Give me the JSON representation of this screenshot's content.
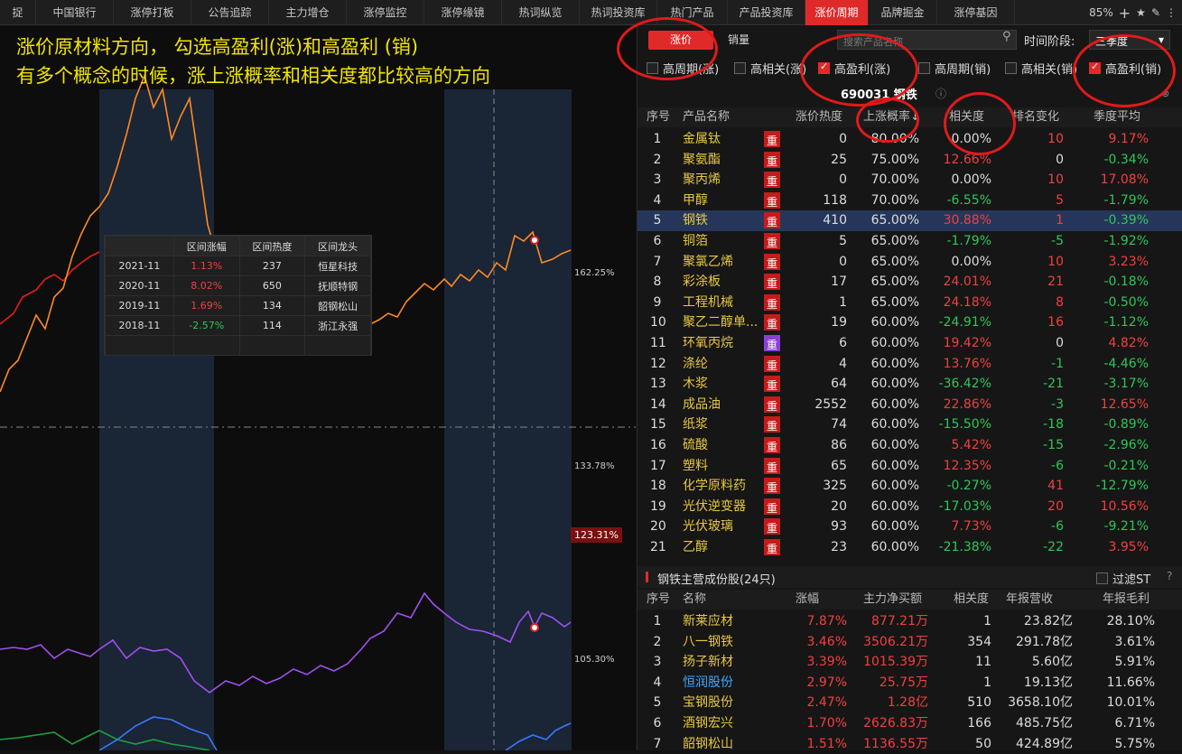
{
  "tabs": [
    "捉",
    "中国银行",
    "涨停打板",
    "公告追踪",
    "主力增仓",
    "涨停监控",
    "涨停缘镜",
    "热词纵览",
    "热词投资库",
    "热门产品",
    "产品投资库",
    "涨价周期",
    "品牌掘金",
    "涨停基因"
  ],
  "active_tab": 11,
  "topright": {
    "zoom": "85%",
    "plus": "+",
    "star": "★",
    "pen": "✎",
    "menu": "⋮"
  },
  "annotation": {
    "line1": "涨价原材料方向， 勾选高盈利(涨)和高盈利 (销)",
    "line2": "有多个概念的时候，涨上涨概率和相关度都比较高的方向"
  },
  "chart": {
    "labels": [
      "162.25%",
      "133.78%",
      "105.30%"
    ],
    "highlight": "123.31%",
    "colors": {
      "orange": "#ff8a1e",
      "red": "#e81c1c",
      "purple": "#a050f0",
      "blue": "#3a78ff",
      "green": "#1ea040"
    }
  },
  "interval_table": {
    "headers": [
      "",
      "区间涨幅",
      "区间热度",
      "区间龙头"
    ],
    "rows": [
      [
        "2021-11",
        "1.13%",
        "237",
        "恒星科技"
      ],
      [
        "2020-11",
        "8.02%",
        "650",
        "抚顺特钢"
      ],
      [
        "2019-11",
        "1.69%",
        "134",
        "韶钢松山"
      ],
      [
        "2018-11",
        "-2.57%",
        "114",
        "浙江永强"
      ]
    ]
  },
  "controls": {
    "price_btn": "涨价",
    "sales_btn": "销量",
    "search_placeholder": "搜索产品名称",
    "period_label": "时间阶段:",
    "period_value": "三季度",
    "period_arrow": "▾",
    "search_icon": "⚲"
  },
  "checkboxes": [
    {
      "label": "高周期(涨)",
      "on": false
    },
    {
      "label": "高相关(涨)",
      "on": false
    },
    {
      "label": "高盈利(涨)",
      "on": true
    },
    {
      "label": "高周期(销)",
      "on": false
    },
    {
      "label": "高相关(销)",
      "on": false
    },
    {
      "label": "高盈利(销)",
      "on": true
    }
  ],
  "product_title": "690031 钢铁",
  "info_icon": "ⓘ",
  "close_icon": "⊗",
  "table1": {
    "headers": [
      "序号",
      "产品名称",
      "涨价热度",
      "上涨概率↓",
      "相关度",
      "排名变化",
      "季度平均"
    ],
    "rows": [
      [
        "1",
        "金属钛",
        "重",
        "0",
        "80.00%",
        "0.00%",
        "10",
        "9.17%"
      ],
      [
        "2",
        "聚氨酯",
        "重",
        "25",
        "75.00%",
        "12.66%",
        "0",
        "-0.34%"
      ],
      [
        "3",
        "聚丙烯",
        "重",
        "0",
        "70.00%",
        "0.00%",
        "10",
        "17.08%"
      ],
      [
        "4",
        "甲醇",
        "重",
        "118",
        "70.00%",
        "-6.55%",
        "5",
        "-1.79%"
      ],
      [
        "5",
        "钢铁",
        "重",
        "410",
        "65.00%",
        "30.88%",
        "1",
        "-0.39%"
      ],
      [
        "6",
        "铜箔",
        "重",
        "5",
        "65.00%",
        "-1.79%",
        "-5",
        "-1.92%"
      ],
      [
        "7",
        "聚氯乙烯",
        "重",
        "0",
        "65.00%",
        "0.00%",
        "10",
        "3.23%"
      ],
      [
        "8",
        "彩涂板",
        "重",
        "17",
        "65.00%",
        "24.01%",
        "21",
        "-0.18%"
      ],
      [
        "9",
        "工程机械",
        "重",
        "1",
        "65.00%",
        "24.18%",
        "8",
        "-0.50%"
      ],
      [
        "10",
        "聚乙二醇单...",
        "重",
        "19",
        "60.00%",
        "-24.91%",
        "16",
        "-1.12%"
      ],
      [
        "11",
        "环氧丙烷",
        "重",
        "6",
        "60.00%",
        "19.42%",
        "0",
        "4.82%"
      ],
      [
        "12",
        "涤纶",
        "重",
        "4",
        "60.00%",
        "13.76%",
        "-1",
        "-4.46%"
      ],
      [
        "13",
        "木浆",
        "重",
        "64",
        "60.00%",
        "-36.42%",
        "-21",
        "-3.17%"
      ],
      [
        "14",
        "成品油",
        "重",
        "2552",
        "60.00%",
        "22.86%",
        "-3",
        "12.65%"
      ],
      [
        "15",
        "纸浆",
        "重",
        "74",
        "60.00%",
        "-15.50%",
        "-18",
        "-0.89%"
      ],
      [
        "16",
        "硫酸",
        "重",
        "86",
        "60.00%",
        "5.42%",
        "-15",
        "-2.96%"
      ],
      [
        "17",
        "塑料",
        "重",
        "65",
        "60.00%",
        "12.35%",
        "-6",
        "-0.21%"
      ],
      [
        "18",
        "化学原料药",
        "重",
        "325",
        "60.00%",
        "-0.27%",
        "41",
        "-12.79%"
      ],
      [
        "19",
        "光伏逆变器",
        "重",
        "20",
        "60.00%",
        "-17.03%",
        "20",
        "10.56%"
      ],
      [
        "20",
        "光伏玻璃",
        "重",
        "93",
        "60.00%",
        "7.73%",
        "-6",
        "-9.21%"
      ],
      [
        "21",
        "乙醇",
        "重",
        "23",
        "60.00%",
        "-21.38%",
        "-22",
        "3.95%"
      ]
    ]
  },
  "section2": {
    "title": "钢铁主营成份股(24只)",
    "filter": "过滤ST",
    "help": "?"
  },
  "table2": {
    "headers": [
      "序号",
      "名称",
      "涨幅",
      "主力净买额",
      "相关度",
      "年报营收",
      "年报毛利"
    ],
    "rows": [
      [
        "1",
        "新莱应材",
        "7.87%",
        "877.21万",
        "1",
        "23.82亿",
        "28.10%"
      ],
      [
        "2",
        "八一钢铁",
        "3.46%",
        "3506.21万",
        "354",
        "291.78亿",
        "3.61%"
      ],
      [
        "3",
        "扬子新材",
        "3.39%",
        "1015.39万",
        "11",
        "5.60亿",
        "5.91%"
      ],
      [
        "4",
        "恒润股份",
        "2.97%",
        "25.75万",
        "1",
        "19.13亿",
        "11.66%"
      ],
      [
        "5",
        "宝钢股份",
        "2.47%",
        "1.28亿",
        "510",
        "3658.10亿",
        "10.01%"
      ],
      [
        "6",
        "酒钢宏兴",
        "1.70%",
        "2626.83万",
        "166",
        "485.75亿",
        "6.71%"
      ],
      [
        "7",
        "韶钢松山",
        "1.51%",
        "1136.55万",
        "50",
        "424.89亿",
        "5.75%"
      ]
    ]
  }
}
